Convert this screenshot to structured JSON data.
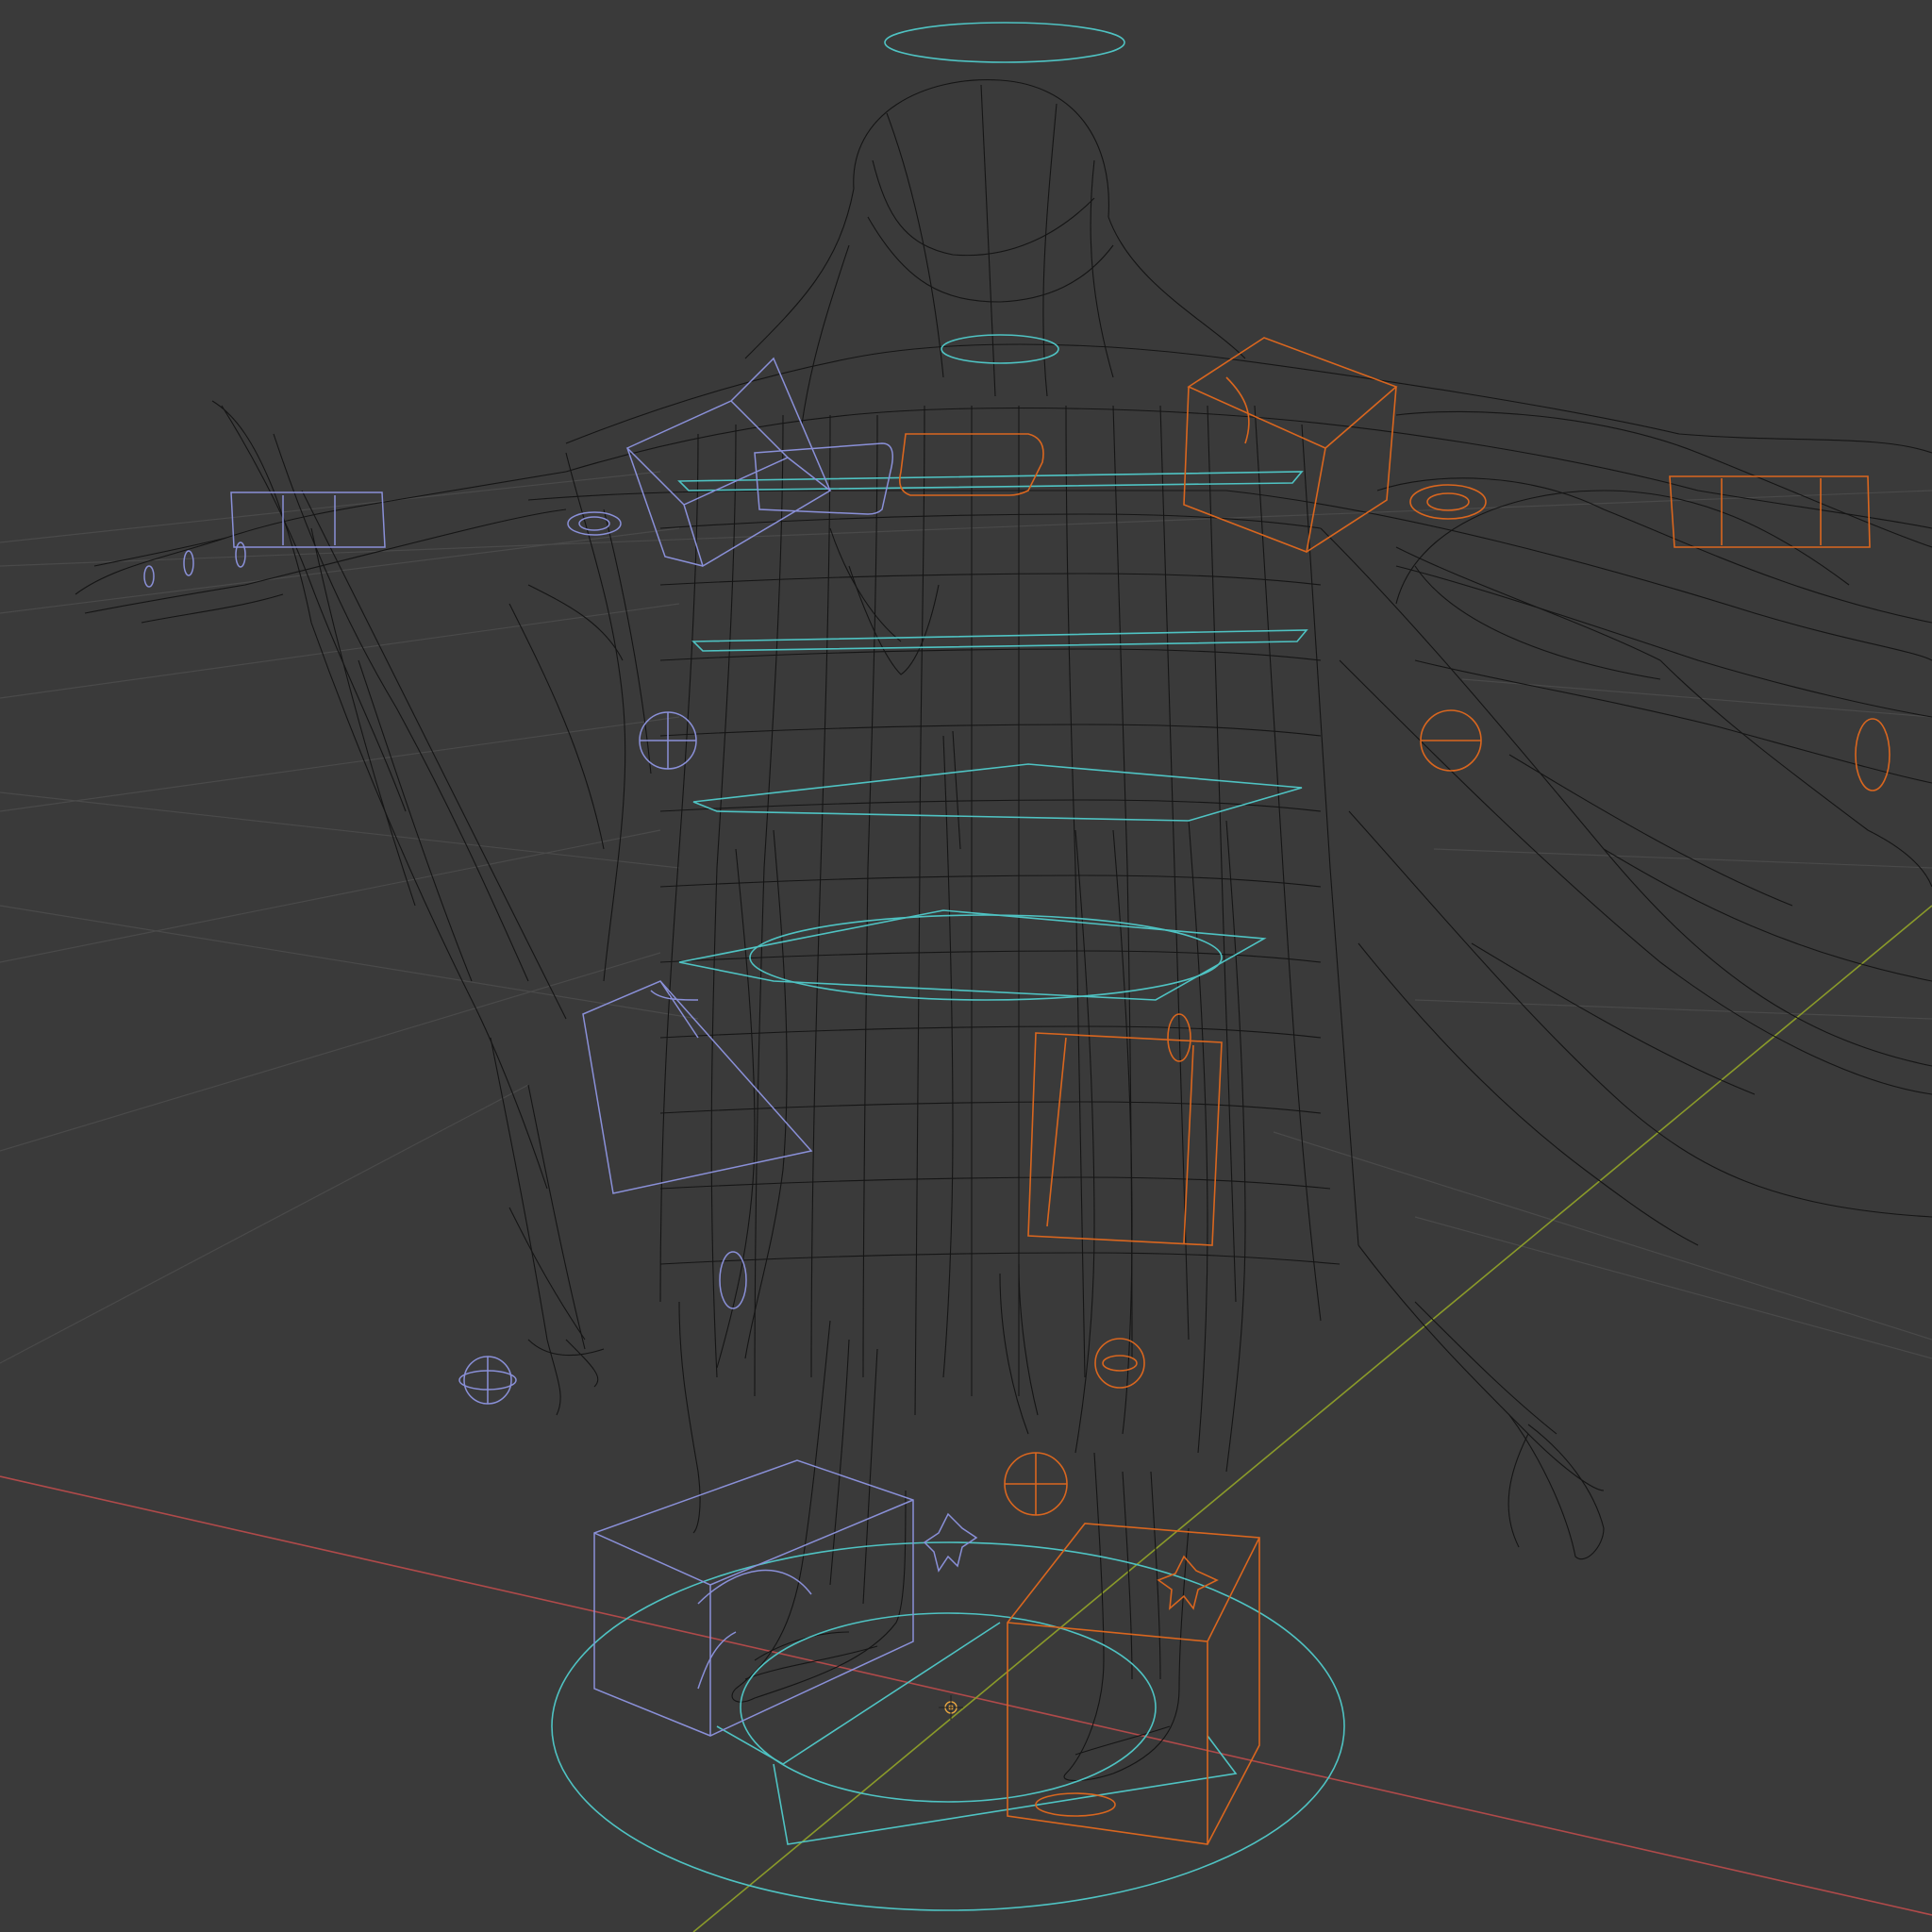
{
  "viewport": {
    "view_mode": "wireframe",
    "colors": {
      "background": "#3a3a3a",
      "grid": "#4a4a4a",
      "axis_x": "#b04a4a",
      "axis_y": "#8a9a2a",
      "mesh": "#151515",
      "rig_center": "#4fc3c3",
      "rig_left": "#8a90d8",
      "rig_right": "#d9661f",
      "origin": "#e8a640"
    }
  },
  "objects": {
    "mesh": {
      "name": "character-wireframe-mesh",
      "icon": "mesh-icon"
    },
    "rig": {
      "name": "armature-controls",
      "icon": "armature-icon"
    },
    "origin": {
      "name": "world-origin",
      "icon": "origin-marker-icon"
    }
  }
}
